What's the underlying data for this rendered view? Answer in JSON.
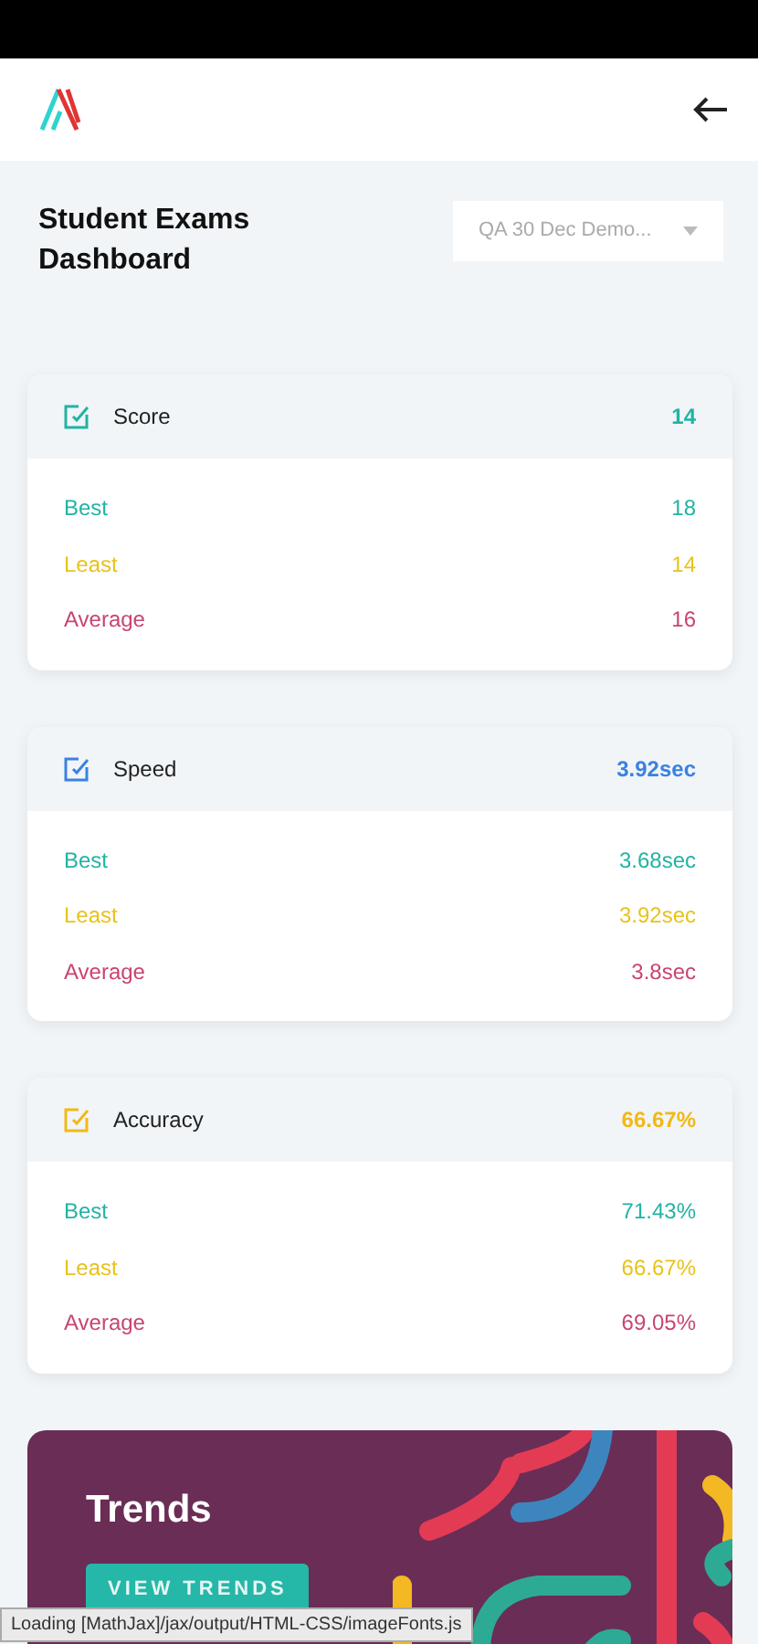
{
  "title": "Student Exams Dashboard",
  "exam_select": {
    "value": "QA 30 Dec Demo..."
  },
  "metrics": [
    {
      "label": "Score",
      "value": "14",
      "color": "#22b3a3",
      "rows": [
        {
          "label": "Best",
          "value": "18",
          "color": "#22b3a3"
        },
        {
          "label": "Least",
          "value": "14",
          "color": "#e8c21c"
        },
        {
          "label": "Average",
          "value": "16",
          "color": "#c8456f"
        }
      ]
    },
    {
      "label": "Speed",
      "value": "3.92sec",
      "color": "#3a82e0",
      "rows": [
        {
          "label": "Best",
          "value": "3.68sec",
          "color": "#22b3a3"
        },
        {
          "label": "Least",
          "value": "3.92sec",
          "color": "#e8c21c"
        },
        {
          "label": "Average",
          "value": "3.8sec",
          "color": "#c8456f"
        }
      ]
    },
    {
      "label": "Accuracy",
      "value": "66.67%",
      "color": "#f2b816",
      "rows": [
        {
          "label": "Best",
          "value": "71.43%",
          "color": "#22b3a3"
        },
        {
          "label": "Least",
          "value": "66.67%",
          "color": "#e8c21c"
        },
        {
          "label": "Average",
          "value": "69.05%",
          "color": "#c8456f"
        }
      ]
    }
  ],
  "trends": {
    "title": "Trends",
    "button": "VIEW TRENDS"
  },
  "loading_status": "Loading [MathJax]/jax/output/HTML-CSS/imageFonts.js"
}
